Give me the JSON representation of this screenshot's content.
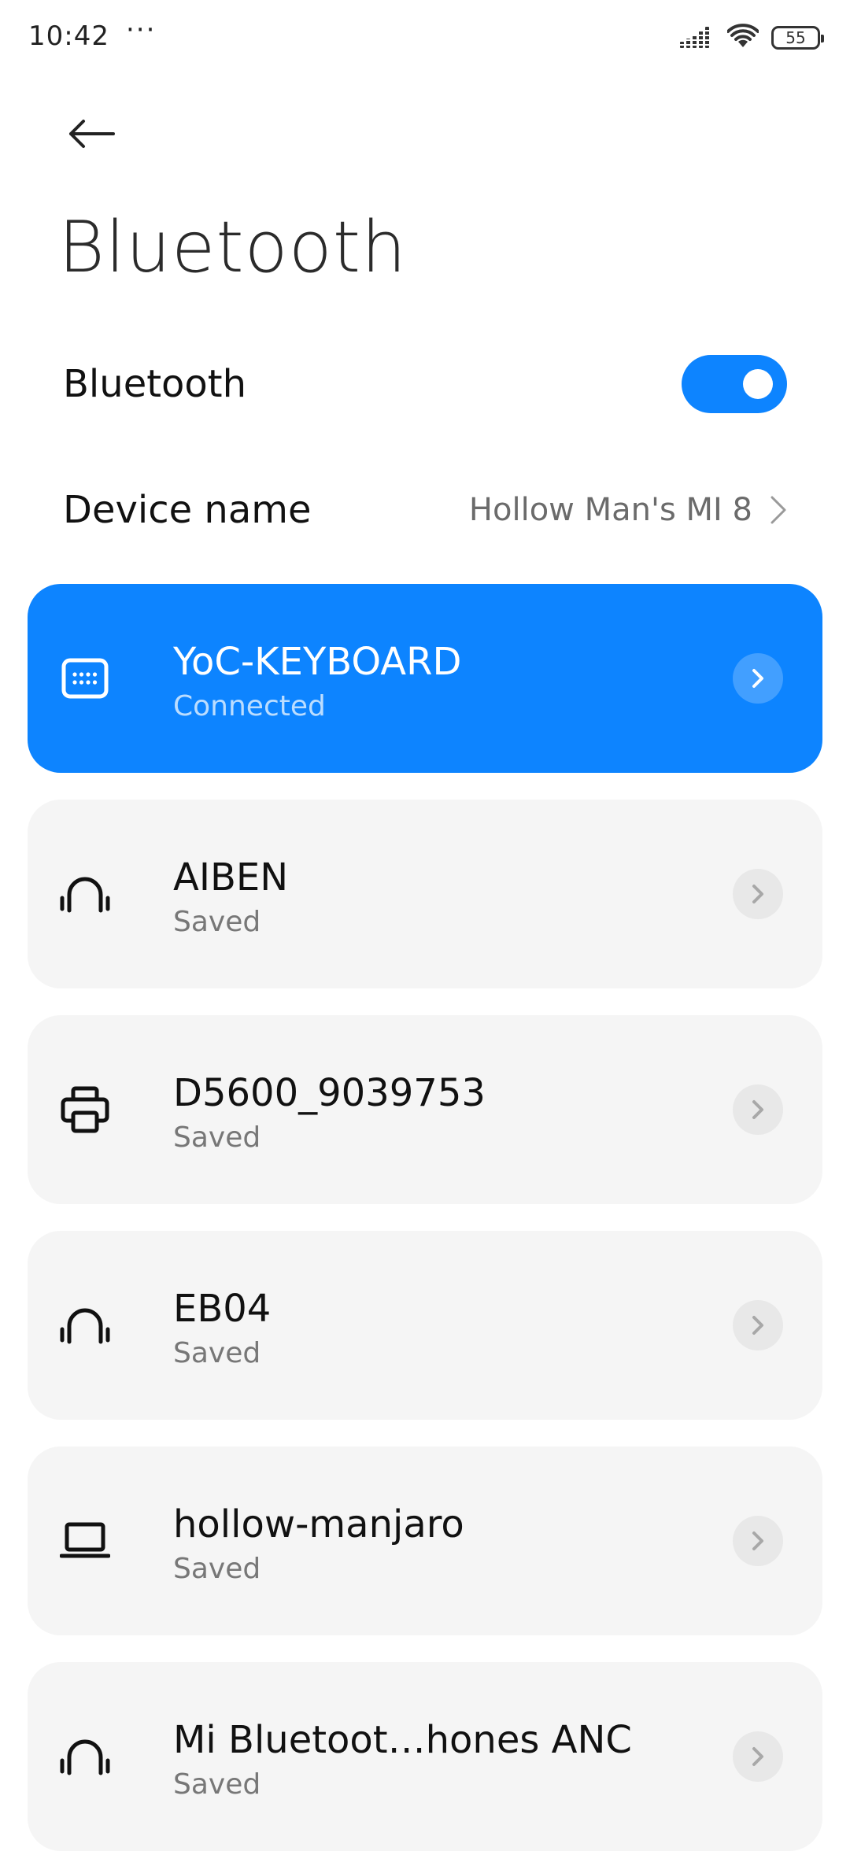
{
  "status_bar": {
    "time": "10:42",
    "more": "···",
    "battery": "55",
    "icons": [
      "signal-icon",
      "wifi-icon",
      "battery-icon"
    ]
  },
  "header": {
    "back_icon": "back-arrow-icon",
    "title": "Bluetooth"
  },
  "bluetooth_toggle": {
    "label": "Bluetooth",
    "enabled": true,
    "accent_color": "#0d84ff"
  },
  "device_name_row": {
    "label": "Device name",
    "value": "Hollow Man's MI 8",
    "icon": "chevron-right-icon"
  },
  "devices": [
    {
      "name": "YoC-KEYBOARD",
      "status": "Connected",
      "icon": "keyboard-icon",
      "connected": true
    },
    {
      "name": "AIBEN",
      "status": "Saved",
      "icon": "headphones-icon",
      "connected": false
    },
    {
      "name": "D5600_9039753",
      "status": "Saved",
      "icon": "printer-icon",
      "connected": false
    },
    {
      "name": "EB04",
      "status": "Saved",
      "icon": "headphones-icon",
      "connected": false
    },
    {
      "name": "hollow-manjaro",
      "status": "Saved",
      "icon": "laptop-icon",
      "connected": false
    },
    {
      "name": "Mi Bluetoot…hones ANC",
      "status": "Saved",
      "icon": "headphones-icon",
      "connected": false
    }
  ]
}
